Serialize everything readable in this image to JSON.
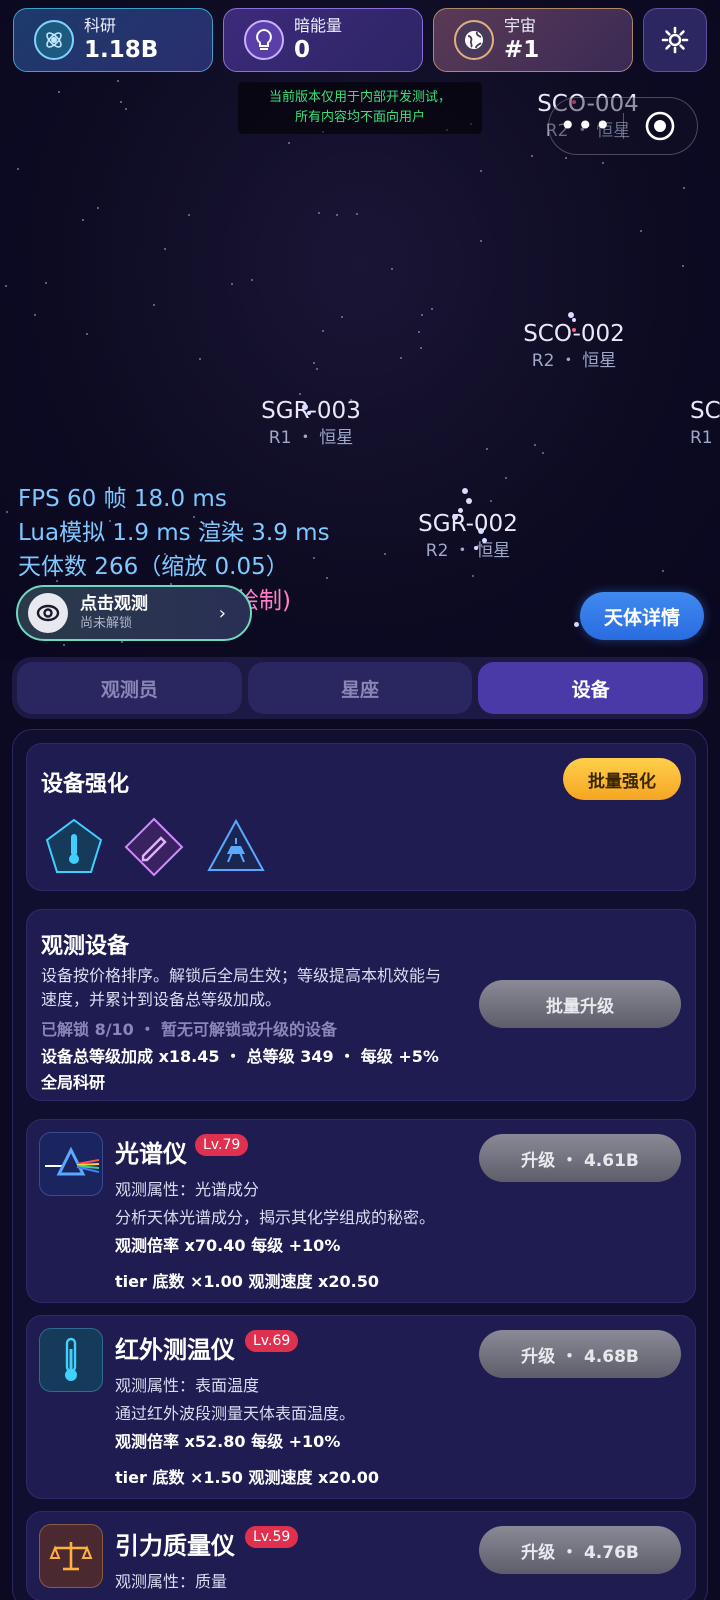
{
  "resources": [
    {
      "label": "科研",
      "value": "1.18B",
      "icon": "atom-icon"
    },
    {
      "label": "暗能量",
      "value": "0",
      "icon": "bulb-icon"
    },
    {
      "label": "宇宙",
      "value": "#1",
      "icon": "globe-icon"
    }
  ],
  "dev_note": {
    "line1": "当前版本仅用于内部开发测试，",
    "line2": "所有内容均不面向用户"
  },
  "capsule": {
    "more": "•••"
  },
  "bodies": [
    {
      "name": "SCO-004",
      "sub": "R2 ・ 恒星"
    },
    {
      "name": "SCO-002",
      "sub": "R2 ・ 恒星"
    },
    {
      "name": "SGR-003",
      "sub": "R1 ・ 恒星"
    },
    {
      "name": "SGR-002",
      "sub": "R2 ・ 恒星"
    },
    {
      "name": "SC",
      "sub": "R1"
    }
  ],
  "debug": {
    "line1": "FPS 60  帧 18.0 ms",
    "line2": "Lua模拟 1.9 ms  渲染 3.9 ms",
    "line3": "天体数 266（缩放 0.05）",
    "line4": "绘制)"
  },
  "observe": {
    "title": "点击观测",
    "sub": "尚未解锁",
    "arrow": "›"
  },
  "detail_button": "天体详情",
  "tabs": [
    {
      "label": "观测员",
      "active": false
    },
    {
      "label": "星座",
      "active": false
    },
    {
      "label": "设备",
      "active": true
    }
  ],
  "enhance": {
    "title": "设备强化",
    "batch": "批量强化"
  },
  "devices": {
    "title": "观测设备",
    "desc": "设备按价格排序。解锁后全局生效；等级提高本机效能与速度，并累计到设备总等级加成。",
    "status": "已解锁 8/10 ・ 暂无可解锁或升级的设备",
    "bonus": "设备总等级加成 x18.45 ・ 总等级 349 ・ 每级 +5% 全局科研",
    "batch_upgrade": "批量升级"
  },
  "items": [
    {
      "name": "光谱仪",
      "level": "Lv.79",
      "attr": "观测属性：光谱成分",
      "desc": "分析天体光谱成分，揭示其化学组成的秘密。",
      "rate": "观测倍率 x70.40   每级 +10%",
      "tier": "tier 底数 ×1.00   观测速度 x20.50",
      "upgrade": "升级 ・ 4.61B",
      "icon": "prism-icon"
    },
    {
      "name": "红外测温仪",
      "level": "Lv.69",
      "attr": "观测属性：表面温度",
      "desc": "通过红外波段测量天体表面温度。",
      "rate": "观测倍率 x52.80   每级 +10%",
      "tier": "tier 底数 ×1.50   观测速度 x20.00",
      "upgrade": "升级 ・ 4.68B",
      "icon": "thermometer-icon"
    },
    {
      "name": "引力质量仪",
      "level": "Lv.59",
      "attr": "观测属性：质量",
      "upgrade": "升级 ・ 4.76B",
      "icon": "scale-icon"
    }
  ],
  "colors": {
    "accent": "#4a3aa8",
    "upgrade_gold": "#f5a623",
    "level_badge": "#e03050",
    "debug_text": "#7fc8ff"
  }
}
